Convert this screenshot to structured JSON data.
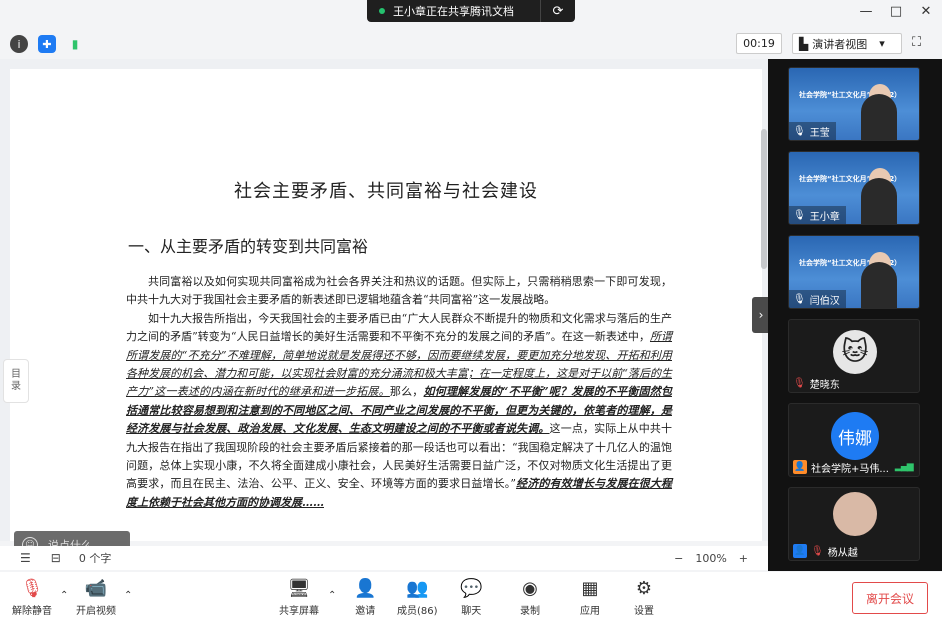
{
  "share_banner": {
    "text": "王小章正在共享腾讯文档"
  },
  "window": {
    "minimize": "—",
    "maximize": "□",
    "close": "✕"
  },
  "info_bar": {
    "timer": "00:19",
    "view_label": "演讲者视图",
    "view_caret": "▾"
  },
  "document": {
    "title": "社会主要矛盾、共同富裕与社会建设",
    "heading": "一、从主要矛盾的转变到共同富裕",
    "p1": "共同富裕以及如何实现共同富裕成为社会各界关注和热议的话题。但实际上，只需稍稍思索一下即可发现，中共十九大对于我国社会主要矛盾的新表述即已逻辑地蕴含着“共同富裕”这一发展战略。",
    "p2a": "如十九大报告所指出，今天我国社会的主要矛盾已由“广大人民群众不断提升的物质和文化需求与落后的生产力之间的矛盾”转变为“人民日益增长的美好生活需要和不平衡不充分的发展之间的矛盾”。在这一新表述中，",
    "p2b": "所谓所谓发展的“不充分”不难理解，简单地说就是发展得还不够，因而要继续发展，要更加充分地发现、开拓和利用各种发展的机会、潜力和可能，以实现社会财富的充分涌流和极大丰富；在一定程度上，这是对于以前“落后的生产力”这一表述的内涵在新时代的继承和进一步拓展。",
    "p2c": "那么，",
    "p2d": "如何理解发展的“不平衡”呢？发展的不平衡固然包括通常比较容易想到和注意到的不同地区之间、不同产业之间发展的不平衡，但更为关键的，依笔者的理解，是经济发展与社会发展、政治发展、文化发展、生态文明建设之间的不平衡或者说失调。",
    "p2e": "这一点，实际上从中共十九大报告在指出了我国现阶段的社会主要矛盾后紧接着的那一段话也可以看出：“我国稳定解决了十几亿人的温饱问题，总体上实现小康，不久将全面建成小康社会，人民美好生活需要日益广泛，不仅对物质文化生活提出了更高要求，而且在民主、法治、公平、正义、安全、环境等方面的要求日益增长。”",
    "p2f": "经济的有效增长与发展在很大程度上依赖于社会其他方面的协调发展……"
  },
  "toc_tab": {
    "line1": "目",
    "line2": "录"
  },
  "comment_box": {
    "placeholder": "说点什么..."
  },
  "status_bar": {
    "count": "0 个字",
    "zoom_minus": "−",
    "zoom": "100%",
    "zoom_plus": "+"
  },
  "participants": [
    {
      "banner": "社会学院“社工文化月”（2022）",
      "name": "王莹"
    },
    {
      "banner": "社会学院“社工文化月”（2022）",
      "name": "王小章"
    },
    {
      "banner": "社会学院“社工文化月”（2022）",
      "name": "闫伯汉"
    },
    {
      "name": "楚晓东"
    },
    {
      "avatar_text": "伟娜",
      "name": "社会学院+马伟..."
    },
    {
      "name": "杨从越"
    }
  ],
  "toolbar": {
    "mute": "解除静音",
    "video": "开启视频",
    "share": "共享屏幕",
    "invite": "邀请",
    "members": "成员(86)",
    "chat": "聊天",
    "record": "录制",
    "apps": "应用",
    "settings": "设置",
    "leave": "离开会议"
  },
  "colors": {
    "accent_blue": "#1e7bf3",
    "leave_red": "#e24a4a",
    "mic_muted": "#e24a4a",
    "signal_green": "#2fc46b"
  }
}
